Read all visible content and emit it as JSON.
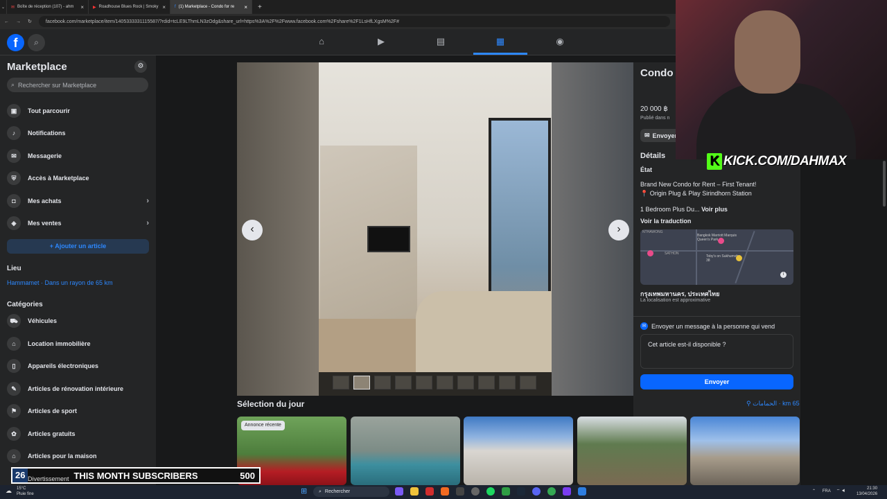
{
  "browser": {
    "tabs": [
      {
        "label": "Boîte de réception (107) - ahm"
      },
      {
        "label": "Roadhouse Blues Rock | Smoky"
      },
      {
        "label": "(1) Marketplace - Condo for re"
      }
    ],
    "url": "facebook.com/marketplace/item/1405333331115587/?rdid=tcLE9LThmLN3zOdg&share_url=https%3A%2F%2Fwww.facebook.com%2Fshare%2F1LsHfLXgsM%2F#"
  },
  "sidebar": {
    "title": "Marketplace",
    "search_placeholder": "Rechercher sur Marketplace",
    "items": [
      {
        "label": "Tout parcourir",
        "icon": "store-icon"
      },
      {
        "label": "Notifications",
        "icon": "bell-icon"
      },
      {
        "label": "Messagerie",
        "icon": "messenger-icon"
      },
      {
        "label": "Accès à Marketplace",
        "icon": "shield-icon"
      },
      {
        "label": "Mes achats",
        "icon": "bag-icon"
      },
      {
        "label": "Mes ventes",
        "icon": "tag-icon"
      }
    ],
    "add_button": "Ajouter un article",
    "location_heading": "Lieu",
    "location": "Hammamet · Dans un rayon de 65 km",
    "categories_heading": "Catégories",
    "categories": [
      {
        "label": "Véhicules",
        "icon": "car-icon"
      },
      {
        "label": "Location immobilière",
        "icon": "house-icon"
      },
      {
        "label": "Appareils électroniques",
        "icon": "device-icon"
      },
      {
        "label": "Articles de rénovation intérieure",
        "icon": "tools-icon"
      },
      {
        "label": "Articles de sport",
        "icon": "sport-icon"
      },
      {
        "label": "Articles gratuits",
        "icon": "gift-icon"
      },
      {
        "label": "Articles pour la maison",
        "icon": "home-goods-icon"
      }
    ]
  },
  "listing": {
    "title": "Condo Condo Sirindh",
    "price": "20 000 ฿",
    "posted": "Publié dans n",
    "send_small": "Envoyer",
    "details_heading": "Détails",
    "condition_label": "État",
    "description_line1": "Brand New Condo for Rent – First Tenant!",
    "description_line2": "📍 Origin Plug & Play Sirindhorn Station",
    "description_line3": "1 Bedroom Plus Du...",
    "see_more": "Voir plus",
    "see_translation": "Voir la traduction",
    "map_city": "กรุงเทพมหานคร, ประเทศไทย",
    "map_note": "La localisation est approximative",
    "map_labels": {
      "a": "NTHAWONG",
      "b": "Bangkok Marriott Marquis Queen's Park",
      "c": "SATHON",
      "d": "Toby's on Sukhumvit 38"
    },
    "message_heading": "Envoyer un message à la personne qui vend",
    "message_value": "Cet article est-il disponible ?",
    "send_button": "Envoyer"
  },
  "feed": {
    "heading": "Sélection du jour",
    "location": "الحمامات · km 65",
    "badge": "Annonce récente"
  },
  "overlay": {
    "kick_text": "KICK.COM/DAHMAX",
    "subs_left": "26",
    "subs_label": "THIS MONTH SUBSCRIBERS",
    "subs_right": "500",
    "divert": "Divertissement"
  },
  "taskbar": {
    "weather_temp": "15°C",
    "weather_desc": "Pluie fine",
    "search": "Rechercher",
    "lang": "FRA",
    "time": "21:30",
    "date": "13/04/2026"
  },
  "colors": {
    "accent": "#2d88ff",
    "primary_button": "#0866ff",
    "background": "#18191a",
    "surface": "#242526"
  }
}
